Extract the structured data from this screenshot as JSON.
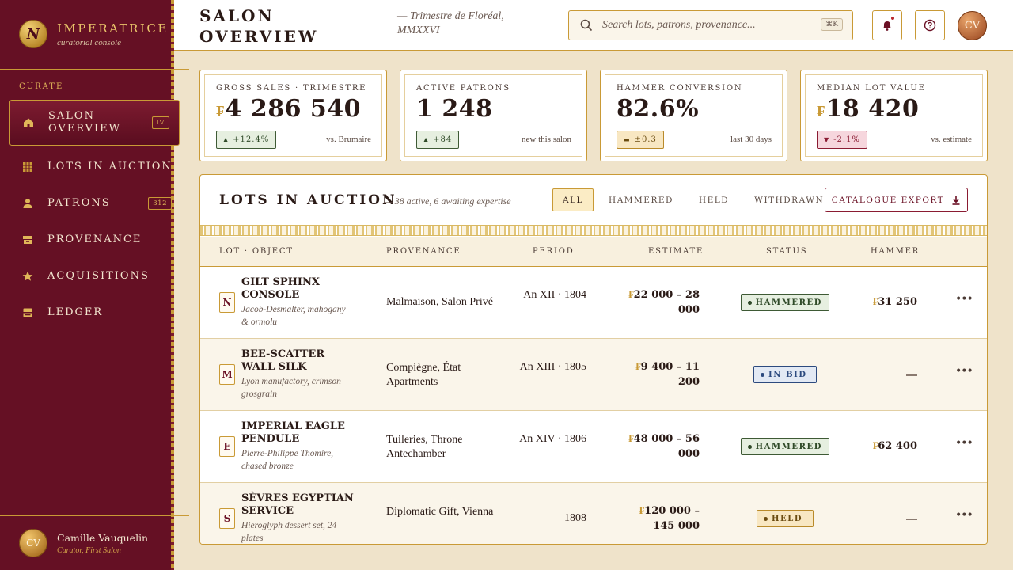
{
  "brand": {
    "name": "IMPERATRICE",
    "subtitle": "curatorial console",
    "seal": "N"
  },
  "sidebar": {
    "section": "CURATE",
    "items": [
      {
        "label": "SALON OVERVIEW",
        "badge": "IV",
        "icon": "home-icon"
      },
      {
        "label": "LOTS IN AUCTION",
        "badge": "",
        "icon": "grid-icon"
      },
      {
        "label": "PATRONS",
        "badge": "312",
        "icon": "person-icon"
      },
      {
        "label": "PROVENANCE",
        "badge": "",
        "icon": "archive-icon"
      },
      {
        "label": "ACQUISITIONS",
        "badge": "",
        "icon": "star-icon"
      },
      {
        "label": "LEDGER",
        "badge": "",
        "icon": "ledger-icon"
      }
    ],
    "user": {
      "initials": "CV",
      "name": "Camille Vauquelin",
      "role": "Curator, First Salon"
    }
  },
  "header": {
    "title": "SALON OVERVIEW",
    "subtitle": "— Trimestre de Floréal, MMXXVI",
    "search_placeholder": "Search lots, patrons, provenance...",
    "shortcut": "⌘K",
    "avatar_initials": "CV"
  },
  "stats": [
    {
      "label": "GROSS SALES · TRIMESTRE",
      "currency": "₣",
      "value": "4 286 540",
      "delta": "+12.4%",
      "trend": "up",
      "note": "vs. Brumaire"
    },
    {
      "label": "ACTIVE PATRONS",
      "currency": "",
      "value": "1 248",
      "delta": "+84",
      "trend": "up",
      "note": "new this salon"
    },
    {
      "label": "HAMMER CONVERSION",
      "currency": "",
      "value": "82.6%",
      "delta": "±0.3",
      "trend": "flat",
      "note": "last 30 days"
    },
    {
      "label": "MEDIAN LOT VALUE",
      "currency": "₣",
      "value": "18 420",
      "delta": "-2.1%",
      "trend": "down",
      "note": "vs. estimate"
    }
  ],
  "lots": {
    "title": "LOTS IN AUCTION",
    "subtitle": "— 38 active, 6 awaiting expertise",
    "filters": [
      "ALL",
      "HAMMERED",
      "HELD",
      "WITHDRAWN"
    ],
    "export_label": "CATALOGUE EXPORT",
    "columns": [
      "LOT · OBJECT",
      "PROVENANCE",
      "PERIOD",
      "ESTIMATE",
      "STATUS",
      "HAMMER"
    ],
    "rows": [
      {
        "mono": "N",
        "name": "GILT SPHINX CONSOLE",
        "desc": "Jacob-Desmalter, mahogany & ormolu",
        "provenance": "Malmaison, Salon Privé",
        "period": "An XII · 1804",
        "currency": "₣",
        "estimate": "22 000 – 28 000",
        "status": "HAMMERED",
        "hammer": "31 250"
      },
      {
        "mono": "M",
        "name": "BEE-SCATTER WALL SILK",
        "desc": "Lyon manufactory, crimson grosgrain",
        "provenance": "Compiègne, État Apartments",
        "period": "An XIII · 1805",
        "currency": "₣",
        "estimate": "9 400 – 11 200",
        "status": "IN BID",
        "hammer": ""
      },
      {
        "mono": "E",
        "name": "IMPERIAL EAGLE PENDULE",
        "desc": "Pierre-Philippe Thomire, chased bronze",
        "provenance": "Tuileries, Throne Antechamber",
        "period": "An XIV · 1806",
        "currency": "₣",
        "estimate": "48 000 – 56 000",
        "status": "HAMMERED",
        "hammer": "62 400"
      },
      {
        "mono": "S",
        "name": "SÈVRES EGYPTIAN SERVICE",
        "desc": "Hieroglyph dessert set, 24 plates",
        "provenance": "Diplomatic Gift, Vienna",
        "period": "1808",
        "currency": "₣",
        "estimate": "120 000 – 145 000",
        "status": "HELD",
        "hammer": ""
      }
    ]
  }
}
